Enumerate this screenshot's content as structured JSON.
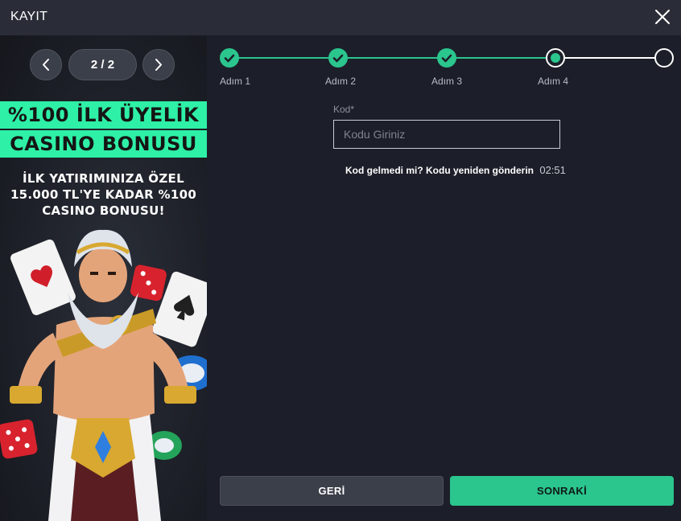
{
  "header": {
    "title": "KAYIT",
    "close_icon": "close-icon"
  },
  "promo": {
    "pager": {
      "counter": "2 / 2",
      "prev_icon": "chevron-left-icon",
      "next_icon": "chevron-right-icon"
    },
    "banner_line1": "%100 İLK ÜYELİK",
    "banner_line2": "CASINO BONUSU",
    "sub_line1": "İLK YATIRIMINIZA ÖZEL",
    "sub_line2": "15.000 TL'YE KADAR %100",
    "sub_line3": "CASINO BONUSU!",
    "accent_color": "#2ef0a6"
  },
  "stepper": {
    "steps": [
      {
        "label": "Adım 1",
        "status": "done"
      },
      {
        "label": "Adım 2",
        "status": "done"
      },
      {
        "label": "Adım 3",
        "status": "done"
      },
      {
        "label": "Adım 4",
        "status": "current"
      },
      {
        "label": "",
        "status": "todo"
      }
    ],
    "active_color": "#2bc58e"
  },
  "form": {
    "code_label": "Kod*",
    "code_placeholder": "Kodu Giriniz",
    "code_value": "",
    "resend_text": "Kod gelmedi mi? Kodu yeniden gönderin",
    "timer": "02:51"
  },
  "actions": {
    "back_label": "GERİ",
    "next_label": "SONRAKİ"
  }
}
